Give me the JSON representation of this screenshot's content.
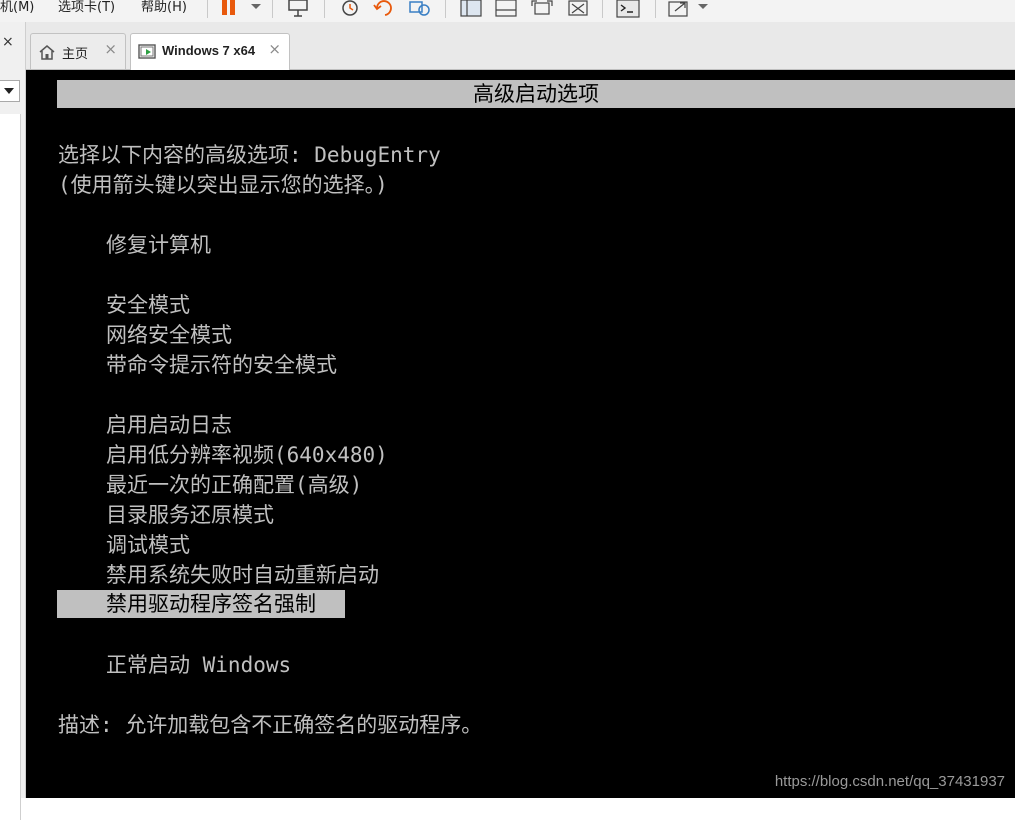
{
  "menubar": {
    "items": [
      "机(M)",
      "选项卡(T)",
      "帮助(H)"
    ]
  },
  "tabs": [
    {
      "label": "主页",
      "icon": "home-icon",
      "close": "×"
    },
    {
      "label": "Windows 7 x64",
      "icon": "vm-running-icon",
      "close": "×"
    }
  ],
  "left_strip": {
    "close": "×"
  },
  "console": {
    "title": "高级启动选项",
    "prompt_line1": "选择以下内容的高级选项: DebugEntry",
    "prompt_line2": "(使用箭头键以突出显示您的选择。)",
    "options": {
      "repair": "修复计算机",
      "safe_mode": "安全模式",
      "safe_mode_network": "网络安全模式",
      "safe_mode_cmd": "带命令提示符的安全模式",
      "boot_logging": "启用启动日志",
      "low_res_video": "启用低分辨率视频(640x480)",
      "last_known_good": "最近一次的正确配置(高级)",
      "ds_restore": "目录服务还原模式",
      "debug_mode": "调试模式",
      "disable_auto_restart": "禁用系统失败时自动重新启动",
      "disable_driver_sig": "禁用驱动程序签名强制",
      "normal_start": "正常启动 Windows"
    },
    "selected_option": "disable_driver_sig",
    "description": "描述: 允许加载包含不正确签名的驱动程序。"
  },
  "watermark": "https://blog.csdn.net/qq_37431937",
  "colors": {
    "console_bg": "#000000",
    "console_text": "#c0c0c0",
    "highlight_bg": "#c0c0c0",
    "highlight_text": "#000000",
    "pause_orange": "#e8590c"
  }
}
